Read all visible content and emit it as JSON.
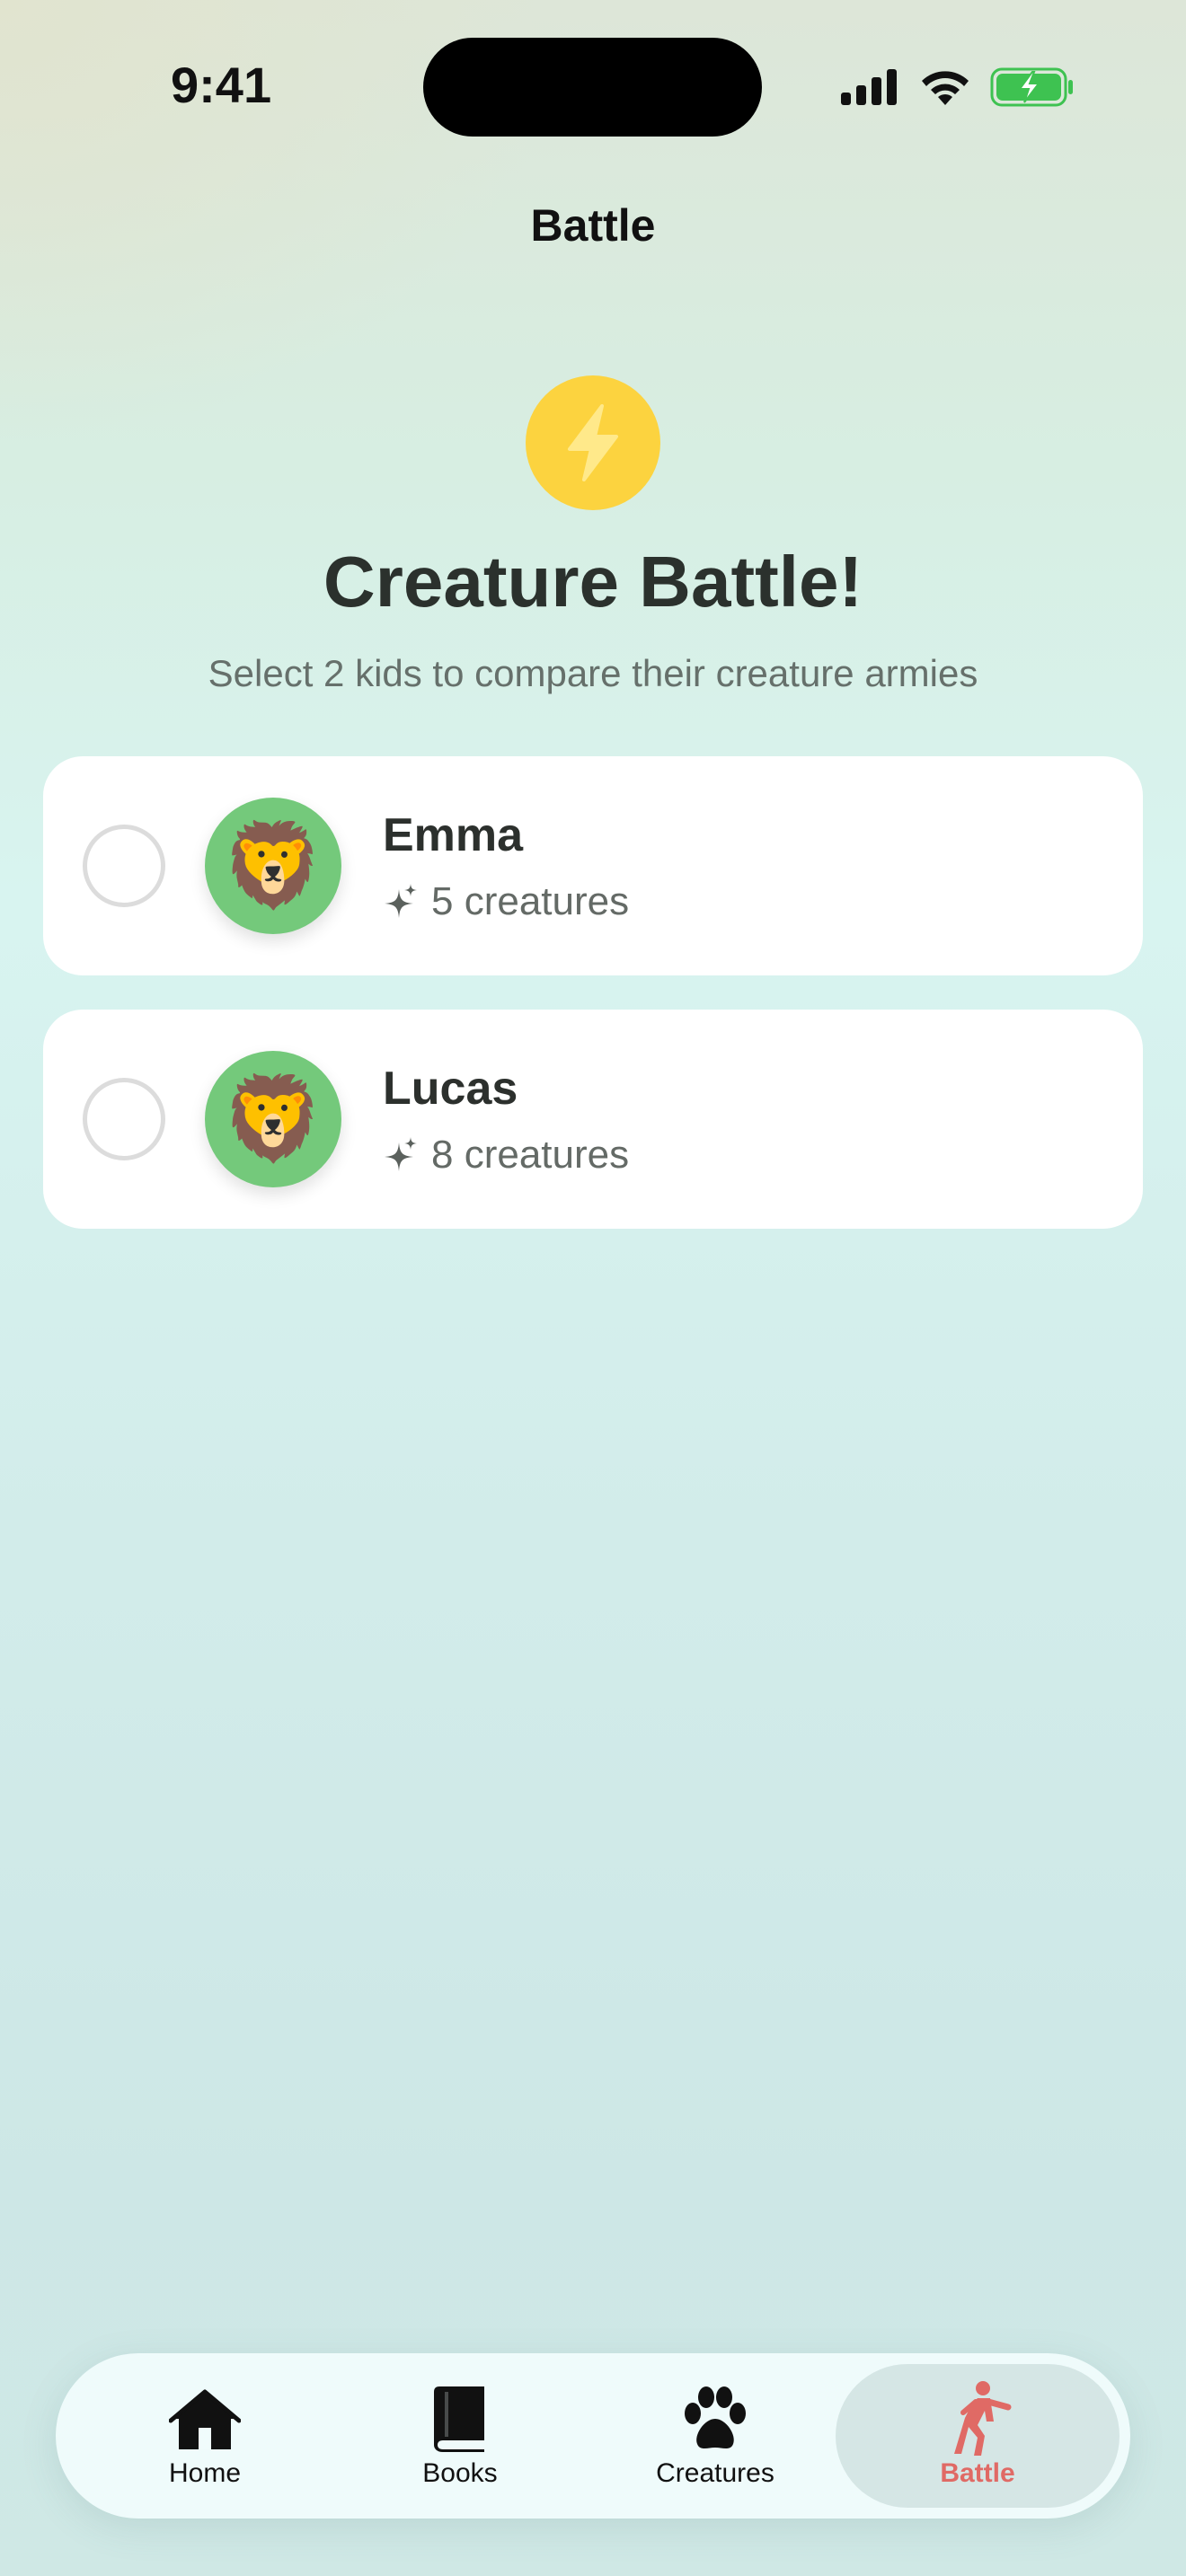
{
  "status_bar": {
    "time": "9:41"
  },
  "nav": {
    "title": "Battle"
  },
  "hero": {
    "icon": "lightning-bolt-icon",
    "title": "Creature Battle!",
    "subtitle": "Select 2 kids to compare their creature armies"
  },
  "kids": [
    {
      "name": "Emma",
      "avatar": "🦁",
      "creatures": "5 creatures",
      "selected": false
    },
    {
      "name": "Lucas",
      "avatar": "🦁",
      "creatures": "8 creatures",
      "selected": false
    }
  ],
  "tabs": [
    {
      "label": "Home",
      "icon": "house-icon",
      "active": false
    },
    {
      "label": "Books",
      "icon": "book-icon",
      "active": false
    },
    {
      "label": "Creatures",
      "icon": "paw-icon",
      "active": false
    },
    {
      "label": "Battle",
      "icon": "fencing-figure-icon",
      "active": true
    }
  ],
  "colors": {
    "accent": "#e06a65",
    "bolt_circle": "#fcd33f",
    "avatar_bg": "#74c97b",
    "battery_green": "#3ec251"
  }
}
